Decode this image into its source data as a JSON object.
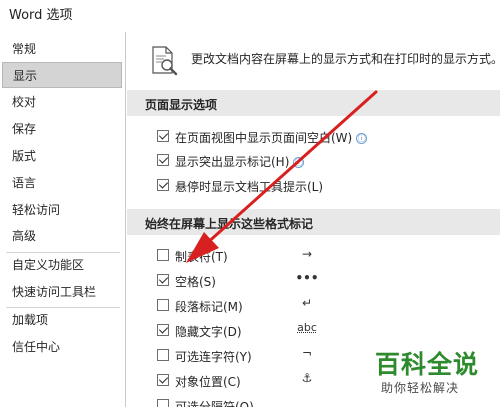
{
  "window": {
    "title": "Word 选项"
  },
  "sidebar": {
    "items": [
      {
        "label": "常规"
      },
      {
        "label": "显示",
        "active": true
      },
      {
        "label": "校对"
      },
      {
        "label": "保存"
      },
      {
        "label": "版式"
      },
      {
        "label": "语言"
      },
      {
        "label": "轻松访问"
      },
      {
        "label": "高级"
      },
      {
        "label": "自定义功能区"
      },
      {
        "label": "快速访问工具栏"
      },
      {
        "label": "加载项"
      },
      {
        "label": "信任中心"
      }
    ]
  },
  "main": {
    "header_text": "更改文档内容在屏幕上的显示方式和在打印时的显示方式。",
    "page_display": {
      "heading": "页面显示选项",
      "options": [
        {
          "label": "在页面视图中显示页面间空白(W)",
          "checked": true,
          "info_icon": "ⓘ"
        },
        {
          "label": "显示突出显示标记(H)",
          "checked": true,
          "info_icon": "ⓘ"
        },
        {
          "label": "悬停时显示文档工具提示(L)",
          "checked": true
        }
      ]
    },
    "format_marks": {
      "heading": "始终在屏幕上显示这些格式标记",
      "options": [
        {
          "label": "制表符(T)",
          "checked": false,
          "symbol": "→"
        },
        {
          "label": "空格(S)",
          "checked": true,
          "symbol": "•••"
        },
        {
          "label": "段落标记(M)",
          "checked": false,
          "symbol": "↵"
        },
        {
          "label": "隐藏文字(D)",
          "checked": true,
          "symbol": "abc"
        },
        {
          "label": "可选连字符(Y)",
          "checked": false,
          "symbol": "¬"
        },
        {
          "label": "对象位置(C)",
          "checked": true,
          "symbol": "⚓"
        },
        {
          "label": "可选分隔符(O)",
          "checked": false,
          "symbol": ""
        }
      ]
    }
  },
  "watermark": {
    "title": "百科全说",
    "subtitle": "助你轻松解决"
  },
  "colors": {
    "annotation_arrow": "#d92020",
    "watermark_green": "#2d8a2d",
    "section_bg": "#e8e8e8",
    "active_item_bg": "#d4d4d4"
  }
}
